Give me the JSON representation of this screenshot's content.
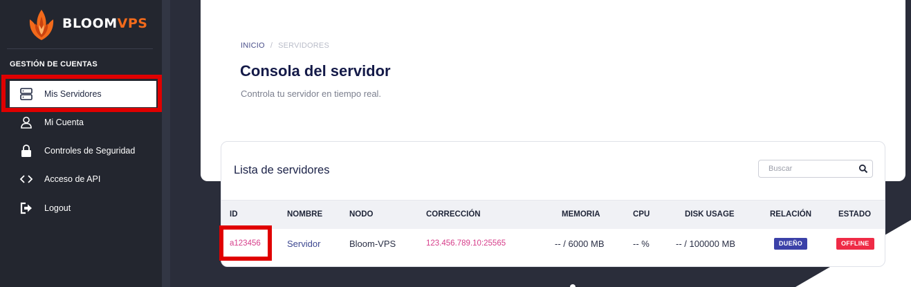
{
  "brand": {
    "name_main": "BLOOM",
    "name_accent": "VPS",
    "accent_color": "#f26a1b"
  },
  "sidebar": {
    "heading": "GESTIÓN DE CUENTAS",
    "items": [
      {
        "label": "Mis Servidores",
        "icon": "server-icon",
        "active": true
      },
      {
        "label": "Mi Cuenta",
        "icon": "user-icon",
        "active": false
      },
      {
        "label": "Controles de Seguridad",
        "icon": "lock-icon",
        "active": false
      },
      {
        "label": "Acceso de API",
        "icon": "code-icon",
        "active": false
      },
      {
        "label": "Logout",
        "icon": "logout-icon",
        "active": false
      }
    ]
  },
  "breadcrumb": {
    "home": "INICIO",
    "separator": "/",
    "current": "SERVIDORES"
  },
  "page": {
    "title": "Consola del servidor",
    "subtitle": "Controla tu servidor en tiempo real."
  },
  "servers_card": {
    "title": "Lista de servidores",
    "search_placeholder": "Buscar",
    "columns": [
      "ID",
      "NOMBRE",
      "NODO",
      "CORRECCIÓN",
      "MEMORIA",
      "CPU",
      "DISK USAGE",
      "RELACIÓN",
      "ESTADO"
    ],
    "rows": [
      {
        "id": "a123456",
        "name": "Servidor",
        "node": "Bloom-VPS",
        "connection": "123.456.789.10:25565",
        "memory": "-- / 6000 MB",
        "cpu": "-- %",
        "disk": "-- / 100000 MB",
        "relation": "DUEÑO",
        "status": "OFFLINE"
      }
    ]
  },
  "colors": {
    "owner_badge": "#3b41a8",
    "offline_badge": "#ef2b46",
    "highlight": "#e00000"
  }
}
